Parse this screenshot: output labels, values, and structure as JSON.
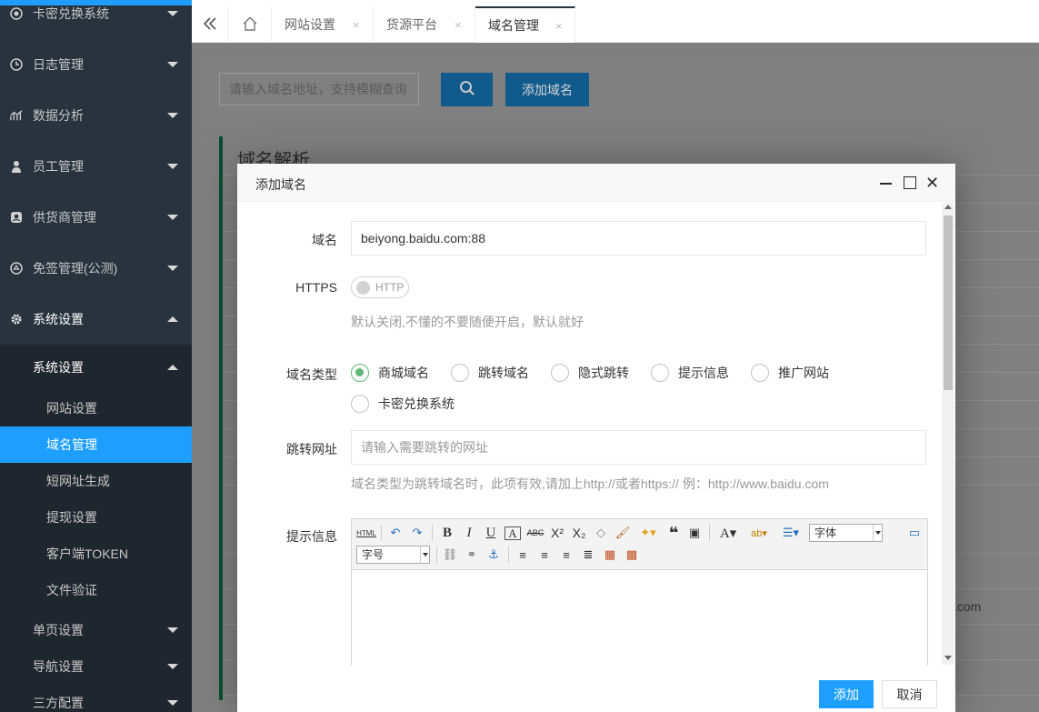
{
  "sidebar": {
    "items": [
      {
        "label": "卡密兑换系统",
        "icon": "settings-gear-icon"
      },
      {
        "label": "日志管理",
        "icon": "clock-icon"
      },
      {
        "label": "数据分析",
        "icon": "chart-icon"
      },
      {
        "label": "员工管理",
        "icon": "user-icon"
      },
      {
        "label": "供货商管理",
        "icon": "supplier-icon"
      },
      {
        "label": "免签管理(公测)",
        "icon": "sign-icon"
      },
      {
        "label": "系统设置",
        "icon": "gear-icon"
      }
    ],
    "sub_group": "系统设置",
    "sub_items": [
      "网站设置",
      "域名管理",
      "短网址生成",
      "提现设置",
      "客户端TOKEN",
      "文件验证"
    ],
    "active_sub": "域名管理",
    "bottom_items": [
      "单页设置",
      "导航设置",
      "三方配置"
    ]
  },
  "tabs": [
    {
      "label": "网站设置"
    },
    {
      "label": "货源平台"
    },
    {
      "label": "域名管理"
    }
  ],
  "tab_close": "×",
  "toolbar": {
    "search_placeholder": "请输入域名地址，支持模糊查询",
    "add_domain_label": "添加域名"
  },
  "background": {
    "section_title": "域名解析",
    "partial_text": ".com"
  },
  "modal": {
    "title": "添加域名",
    "domain_label": "域名",
    "domain_value": "beiyong.baidu.com:88",
    "https_label": "HTTPS",
    "https_switch_text": "HTTP",
    "https_hint": "默认关闭,不懂的不要随便开启，默认就好",
    "type_label": "域名类型",
    "type_options": [
      "商城域名",
      "跳转域名",
      "隐式跳转",
      "提示信息",
      "推广网站",
      "卡密兑换系统"
    ],
    "type_selected": "商城域名",
    "redirect_label": "跳转网址",
    "redirect_placeholder": "请输入需要跳转的网址",
    "redirect_hint": "域名类型为跳转域名时，此项有效,请加上http://或者https:// 例：http://www.baidu.com",
    "tip_label": "提示信息",
    "editor": {
      "html_btn": "HTML",
      "font_select": "字体",
      "size_select": "字号"
    },
    "ok_label": "添加",
    "cancel_label": "取消"
  },
  "colors": {
    "sidebar_bg": "#28333e",
    "accent": "#1e9fff",
    "radio_on": "#5fb878"
  }
}
